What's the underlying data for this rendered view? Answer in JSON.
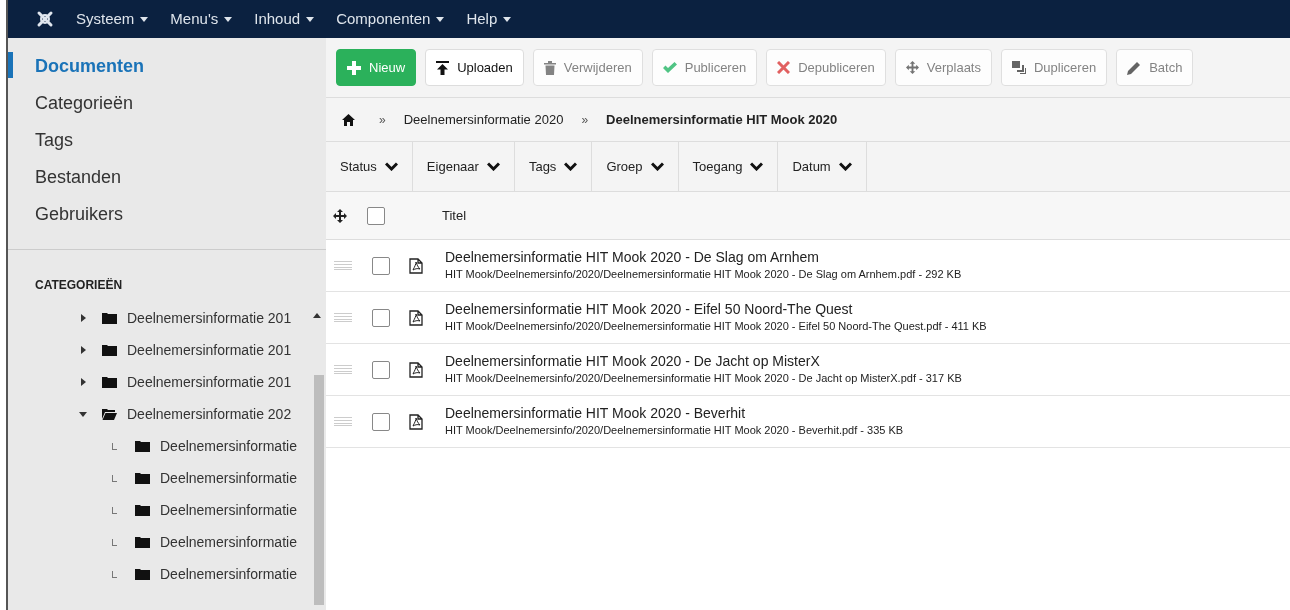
{
  "top_menu": [
    {
      "label": "Systeem"
    },
    {
      "label": "Menu's"
    },
    {
      "label": "Inhoud"
    },
    {
      "label": "Componenten"
    },
    {
      "label": "Help"
    }
  ],
  "sidebar": {
    "items": [
      {
        "label": "Documenten",
        "selected": true
      },
      {
        "label": "Categorieën",
        "selected": false
      },
      {
        "label": "Tags",
        "selected": false
      },
      {
        "label": "Bestanden",
        "selected": false
      },
      {
        "label": "Gebruikers",
        "selected": false
      }
    ],
    "categories_heading": "CATEGORIEËN",
    "categories": [
      {
        "label": "Deelnemersinformatie 201",
        "expanded": false
      },
      {
        "label": "Deelnemersinformatie 201",
        "expanded": false
      },
      {
        "label": "Deelnemersinformatie 201",
        "expanded": false
      },
      {
        "label": "Deelnemersinformatie 202",
        "expanded": true,
        "children": [
          {
            "label": "Deelnemersinformatie"
          },
          {
            "label": "Deelnemersinformatie"
          },
          {
            "label": "Deelnemersinformatie"
          },
          {
            "label": "Deelnemersinformatie"
          },
          {
            "label": "Deelnemersinformatie"
          }
        ]
      }
    ]
  },
  "toolbar": [
    {
      "label": "Nieuw",
      "kind": "primary",
      "disabled": false
    },
    {
      "label": "Uploaden",
      "kind": "default",
      "disabled": false
    },
    {
      "label": "Verwijderen",
      "kind": "default",
      "disabled": true
    },
    {
      "label": "Publiceren",
      "kind": "default",
      "disabled": true
    },
    {
      "label": "Depubliceren",
      "kind": "default",
      "disabled": true
    },
    {
      "label": "Verplaats",
      "kind": "default",
      "disabled": true
    },
    {
      "label": "Dupliceren",
      "kind": "default",
      "disabled": true
    },
    {
      "label": "Batch",
      "kind": "default",
      "disabled": true
    }
  ],
  "breadcrumb": [
    {
      "label": "Deelnemersinformatie 2020",
      "current": false
    },
    {
      "label": "Deelnemersinformatie HIT Mook 2020",
      "current": true
    }
  ],
  "breadcrumb_separator": "»",
  "filters": [
    {
      "label": "Status"
    },
    {
      "label": "Eigenaar"
    },
    {
      "label": "Tags"
    },
    {
      "label": "Groep"
    },
    {
      "label": "Toegang"
    },
    {
      "label": "Datum"
    }
  ],
  "table": {
    "select_all_checked": false,
    "columns": [
      {
        "label": "Titel"
      }
    ],
    "rows": [
      {
        "title": "Deelnemersinformatie HIT Mook 2020 - De Slag om Arnhem",
        "file": "HIT Mook/Deelnemersinfo/2020/Deelnemersinformatie HIT Mook 2020 - De Slag om Arnhem.pdf - 292 KB",
        "checked": false
      },
      {
        "title": "Deelnemersinformatie HIT Mook 2020 - Eifel 50 Noord-The Quest",
        "file": "HIT Mook/Deelnemersinfo/2020/Deelnemersinformatie HIT Mook 2020 - Eifel 50 Noord-The Quest.pdf - 411 KB",
        "checked": false
      },
      {
        "title": "Deelnemersinformatie HIT Mook 2020 - De Jacht op MisterX",
        "file": "HIT Mook/Deelnemersinfo/2020/Deelnemersinformatie HIT Mook 2020 - De Jacht op MisterX.pdf - 317 KB",
        "checked": false
      },
      {
        "title": "Deelnemersinformatie HIT Mook 2020 - Beverhit",
        "file": "HIT Mook/Deelnemersinfo/2020/Deelnemersinformatie HIT Mook 2020 - Beverhit.pdf - 335 KB",
        "checked": false
      }
    ]
  }
}
